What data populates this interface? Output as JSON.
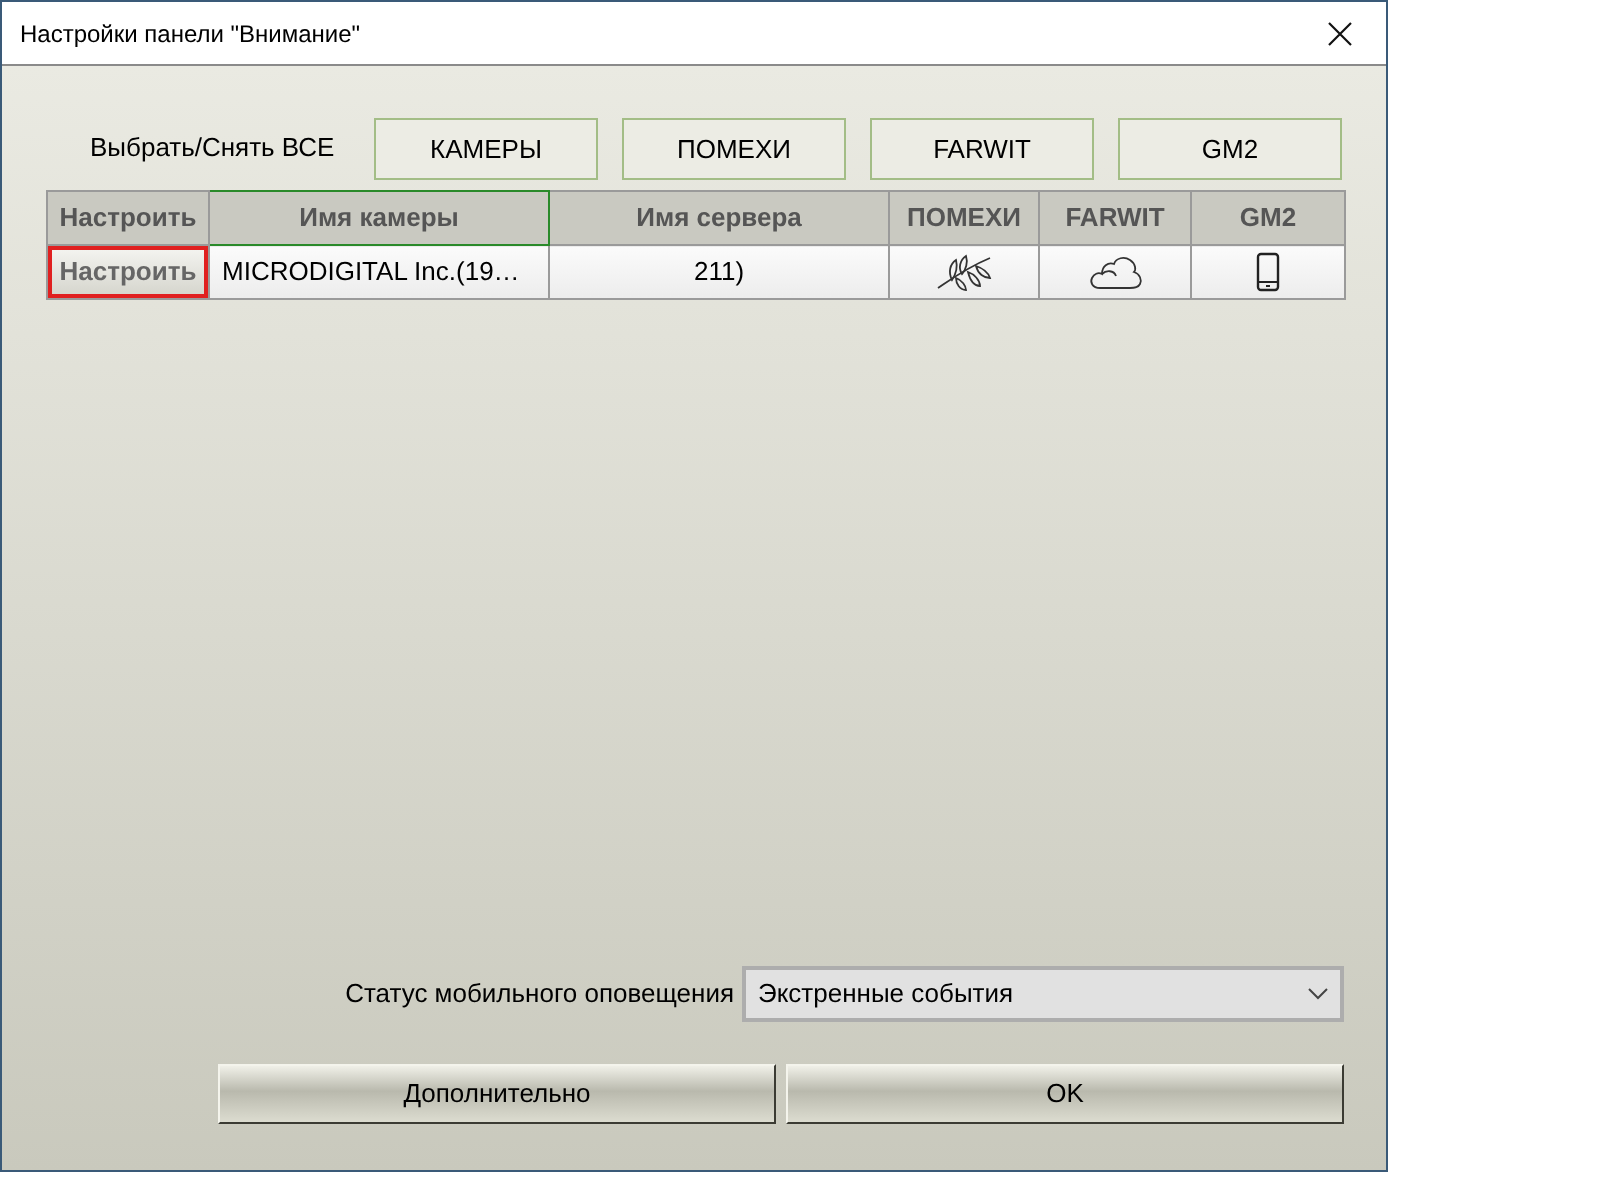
{
  "window": {
    "title": "Настройки панели \"Внимание\""
  },
  "select_all": {
    "label": "Выбрать/Снять ВСЕ",
    "buttons": [
      "КАМЕРЫ",
      "ПОМЕХИ",
      "FARWIT",
      "GM2"
    ]
  },
  "table": {
    "columns": [
      {
        "label": "Настроить",
        "selected": false
      },
      {
        "label": "Имя камеры",
        "selected": true
      },
      {
        "label": "Имя сервера",
        "selected": false
      },
      {
        "label": "ПОМЕХИ",
        "selected": false
      },
      {
        "label": "FARWIT",
        "selected": false
      },
      {
        "label": "GM2",
        "selected": false
      }
    ],
    "rows": [
      {
        "cells": [
          {
            "kind": "button",
            "text": "Настроить",
            "focused": true
          },
          {
            "kind": "text",
            "text": "MICRODIGITAL Inc.(19…"
          },
          {
            "kind": "text",
            "text": "211)"
          },
          {
            "kind": "icon"
          },
          {
            "kind": "icon"
          },
          {
            "kind": "icon"
          }
        ]
      }
    ]
  },
  "notification": {
    "label": "Статус мобильного оповещения",
    "value": "Экстренные события"
  },
  "buttons": [
    "Дополнительно",
    "OK"
  ]
}
